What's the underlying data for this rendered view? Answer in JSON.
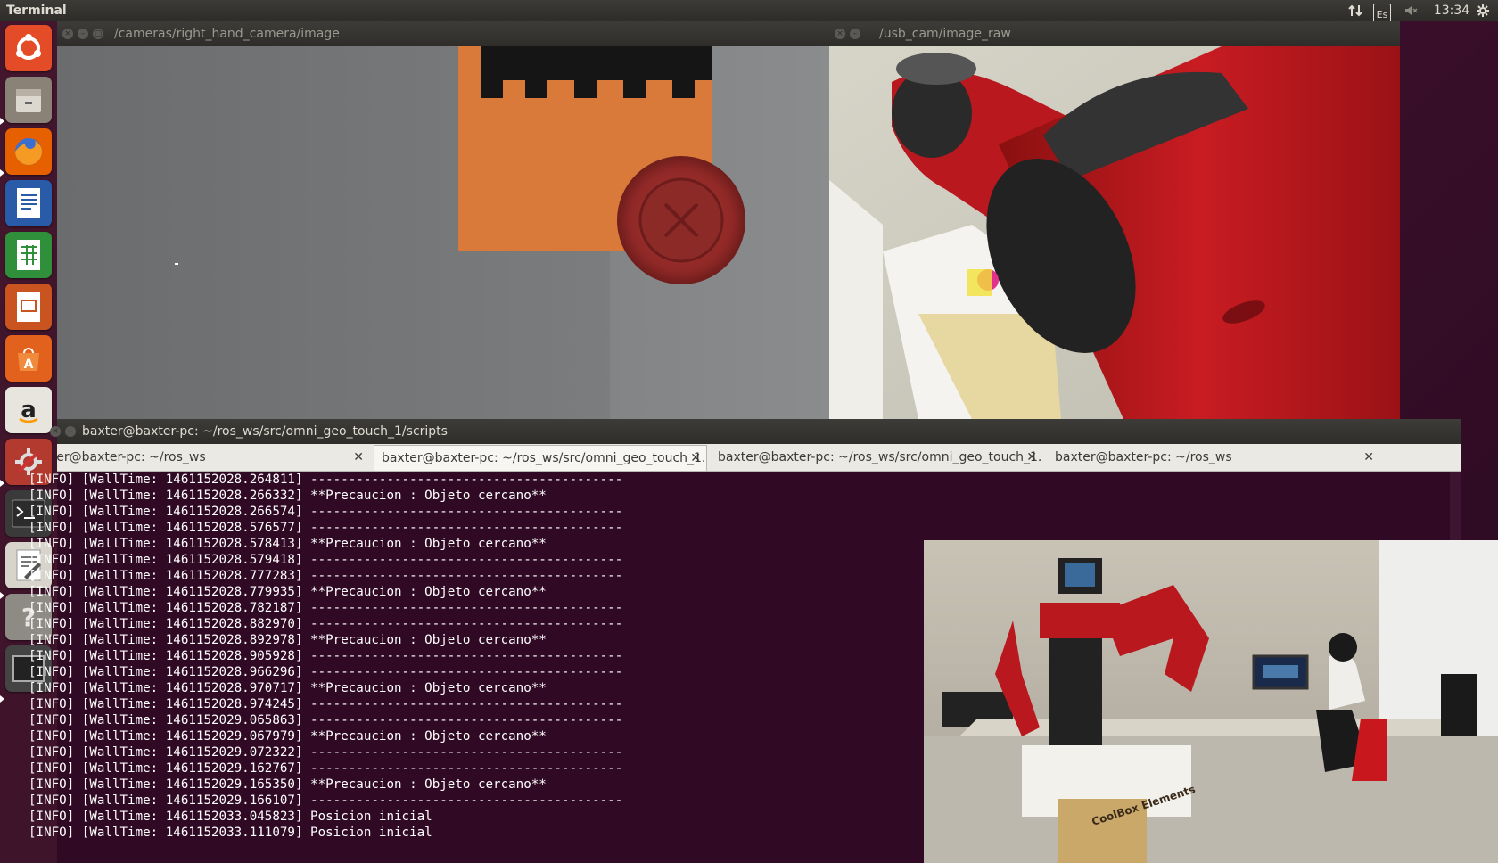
{
  "top_panel": {
    "app_title": "Terminal",
    "keyboard": "Es",
    "clock": "13:34",
    "icons": [
      "network-arrows-icon",
      "keyboard-layout-icon",
      "volume-muted-icon",
      "gear-icon"
    ]
  },
  "launcher": {
    "items": [
      {
        "name": "ubuntu-dash-icon",
        "color": "#e34c26"
      },
      {
        "name": "files-icon",
        "color": "#8a8276"
      },
      {
        "name": "firefox-icon",
        "color": "#e66000"
      },
      {
        "name": "writer-icon",
        "color": "#2a5ba8"
      },
      {
        "name": "calc-icon",
        "color": "#2f8f3a"
      },
      {
        "name": "impress-icon",
        "color": "#c9541f"
      },
      {
        "name": "software-center-icon",
        "color": "#e2611c"
      },
      {
        "name": "amazon-icon",
        "color": "#e8e5df"
      },
      {
        "name": "system-settings-icon",
        "color": "#b33a2f"
      },
      {
        "name": "terminal-icon",
        "color": "#3a3a3a"
      },
      {
        "name": "text-editor-icon",
        "color": "#d8d4cc"
      },
      {
        "name": "help-icon",
        "color": "#8e8b85"
      },
      {
        "name": "workspace-icon",
        "color": "#444"
      }
    ]
  },
  "windows": {
    "cam_left": {
      "title": "/cameras/right_hand_camera/image"
    },
    "cam_right": {
      "title": "/usb_cam/image_raw"
    }
  },
  "terminal": {
    "title": "baxter@baxter-pc: ~/ros_ws/src/omni_geo_touch_1/scripts",
    "tabs": [
      {
        "label": "baxter@baxter-pc: ~/ros_ws",
        "active": false
      },
      {
        "label": "baxter@baxter-pc: ~/ros_ws/src/omni_geo_touch_1...",
        "active": true
      },
      {
        "label": "baxter@baxter-pc: ~/ros_ws/src/omni_geo_touch_1...",
        "active": false
      },
      {
        "label": "baxter@baxter-pc: ~/ros_ws",
        "active": false
      }
    ],
    "lines": [
      "[INFO] [WallTime: 1461152028.264811] -----------------------------------------",
      "[INFO] [WallTime: 1461152028.266332] **Precaucion : Objeto cercano**",
      "[INFO] [WallTime: 1461152028.266574] -----------------------------------------",
      "[INFO] [WallTime: 1461152028.576577] -----------------------------------------",
      "[INFO] [WallTime: 1461152028.578413] **Precaucion : Objeto cercano**",
      "[INFO] [WallTime: 1461152028.579418] -----------------------------------------",
      "[INFO] [WallTime: 1461152028.777283] -----------------------------------------",
      "[INFO] [WallTime: 1461152028.779935] **Precaucion : Objeto cercano**",
      "[INFO] [WallTime: 1461152028.782187] -----------------------------------------",
      "[INFO] [WallTime: 1461152028.882970] -----------------------------------------",
      "[INFO] [WallTime: 1461152028.892978] **Precaucion : Objeto cercano**",
      "[INFO] [WallTime: 1461152028.905928] -----------------------------------------",
      "[INFO] [WallTime: 1461152028.966296] -----------------------------------------",
      "[INFO] [WallTime: 1461152028.970717] **Precaucion : Objeto cercano**",
      "[INFO] [WallTime: 1461152028.974245] -----------------------------------------",
      "[INFO] [WallTime: 1461152029.065863] -----------------------------------------",
      "[INFO] [WallTime: 1461152029.067979] **Precaucion : Objeto cercano**",
      "[INFO] [WallTime: 1461152029.072322] -----------------------------------------",
      "[INFO] [WallTime: 1461152029.162767] -----------------------------------------",
      "[INFO] [WallTime: 1461152029.165350] **Precaucion : Objeto cercano**",
      "[INFO] [WallTime: 1461152029.166107] -----------------------------------------",
      "[INFO] [WallTime: 1461152033.045823] Posicion inicial",
      "[INFO] [WallTime: 1461152033.111079] Posicion inicial"
    ]
  },
  "overlay_photo": {
    "box_text": "CoolBox Elements"
  }
}
